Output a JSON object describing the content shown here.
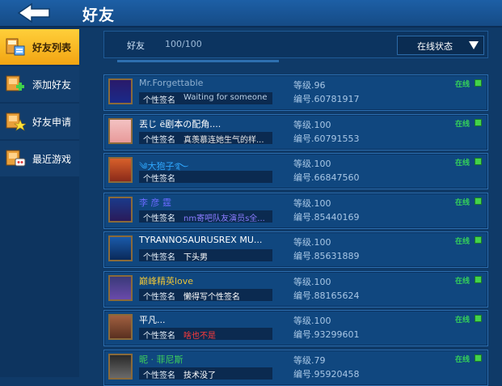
{
  "header": {
    "title": "好友"
  },
  "sidebar": {
    "items": [
      {
        "label": "好友列表",
        "icon": "friend-list-icon",
        "active": true
      },
      {
        "label": "添加好友",
        "icon": "add-friend-icon",
        "active": false
      },
      {
        "label": "好友申请",
        "icon": "friend-request-icon",
        "active": false
      },
      {
        "label": "最近游戏",
        "icon": "recent-games-icon",
        "active": false
      }
    ]
  },
  "filter": {
    "label": "好友",
    "count": "100/100",
    "status_value": "在线状态"
  },
  "colors": {
    "online": "#34d05a",
    "accent": "#f2a412",
    "card": "#10477f"
  },
  "friends": [
    {
      "name": "Mr.Forgettable",
      "name_color": "#8fb0d0",
      "sig_label": "个性签名",
      "signature": "Waiting for someone",
      "sig_color": "#b8cfe6",
      "level": "等级.96",
      "id": "编号.60781917",
      "status": "在线"
    },
    {
      "name": "丟じ ё剧本の配角....",
      "name_color": "#ffffff",
      "sig_label": "个性签名",
      "signature": "真羡慕连她生气的样...",
      "sig_color": "#e8e8e8",
      "level": "等级.100",
      "id": "编号.60791553",
      "status": "在线"
    },
    {
      "name": "༄大狍子࿐",
      "name_color": "#2fa8ff",
      "sig_label": "个性签名",
      "signature": "",
      "sig_color": "#ffffff",
      "level": "等级.100",
      "id": "编号.66847560",
      "status": "在线"
    },
    {
      "name": "李 彦 霆",
      "name_color": "#6a6aff",
      "sig_label": "个性签名",
      "signature": "nm寄吧队友演员s全...",
      "sig_color": "#8a7bff",
      "level": "等级.100",
      "id": "编号.85440169",
      "status": "在线"
    },
    {
      "name": "TYRANNOSAURUSREX MU...",
      "name_color": "#ffffff",
      "sig_label": "个性签名",
      "signature": "下头男",
      "sig_color": "#ffffff",
      "level": "等级.100",
      "id": "编号.85631889",
      "status": "在线"
    },
    {
      "name": "巅峰精英love",
      "name_color": "#e8c23a",
      "sig_label": "个性签名",
      "signature": "懒得写个性签名",
      "sig_color": "#ffffff",
      "level": "等级.100",
      "id": "编号.88165624",
      "status": "在线"
    },
    {
      "name": "平凡...",
      "name_color": "#ffffff",
      "sig_label": "个性签名",
      "signature": "啥也不是",
      "sig_color": "#ff3b3b",
      "level": "等级.100",
      "id": "编号.93299601",
      "status": "在线"
    },
    {
      "name": "昵 · 菲尼斯",
      "name_color": "#3fd05a",
      "sig_label": "个性签名",
      "signature": "技术没了",
      "sig_color": "#ffffff",
      "level": "等级.79",
      "id": "编号.95920458",
      "status": "在线"
    }
  ]
}
